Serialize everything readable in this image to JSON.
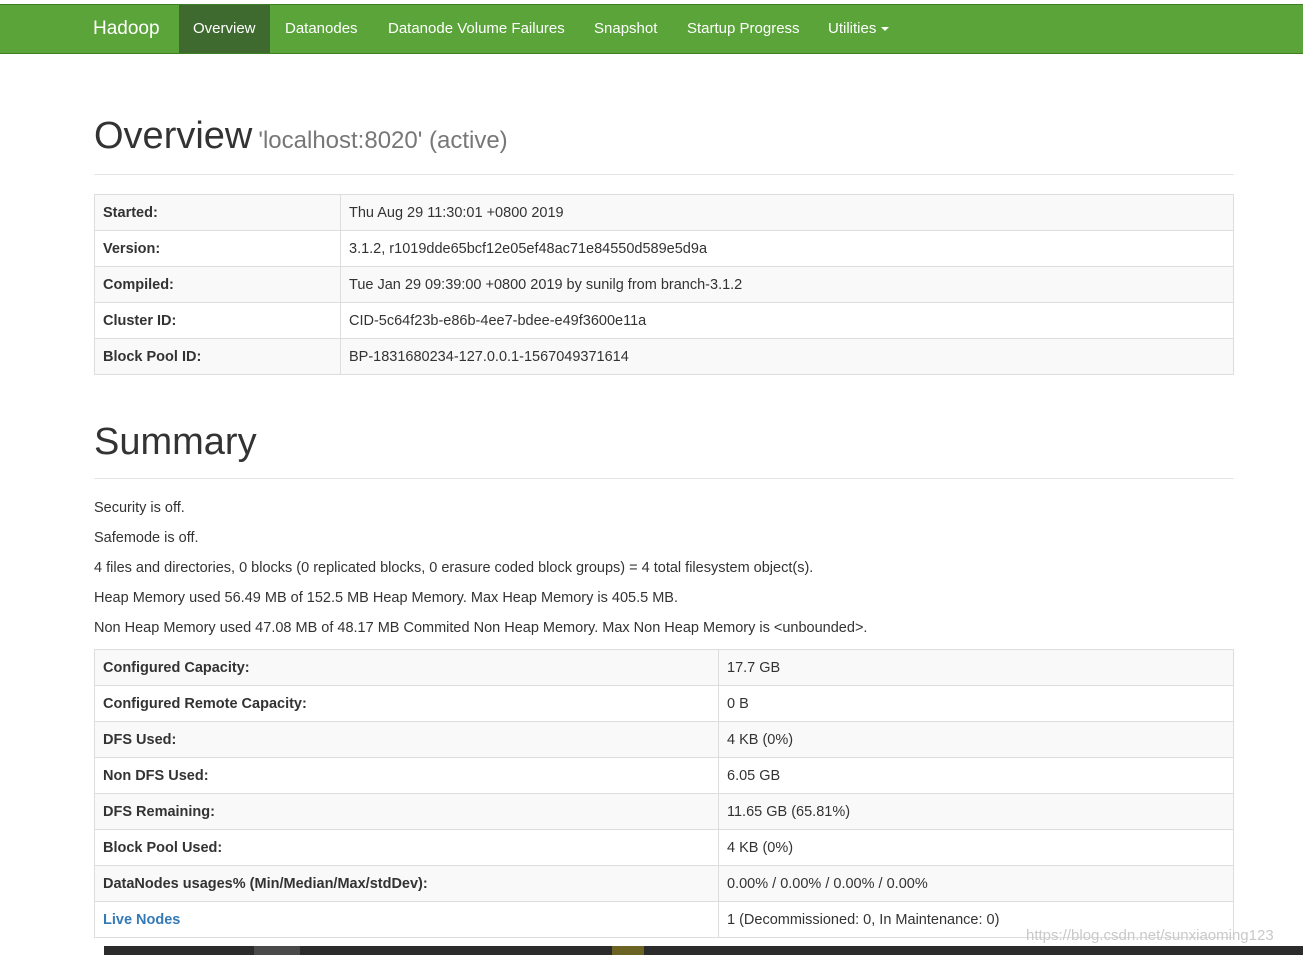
{
  "navbar": {
    "brand": "Hadoop",
    "items": [
      {
        "label": "Overview",
        "active": true
      },
      {
        "label": "Datanodes"
      },
      {
        "label": "Datanode Volume Failures"
      },
      {
        "label": "Snapshot"
      },
      {
        "label": "Startup Progress"
      },
      {
        "label": "Utilities"
      }
    ],
    "color": "#5aa43a",
    "active_color": "#3e6a2f"
  },
  "overview": {
    "title": "Overview",
    "subtitle": "'localhost:8020' (active)",
    "rows": [
      {
        "label": "Started:",
        "value": "Thu Aug 29 11:30:01 +0800 2019"
      },
      {
        "label": "Version:",
        "value": "3.1.2, r1019dde65bcf12e05ef48ac71e84550d589e5d9a"
      },
      {
        "label": "Compiled:",
        "value": "Tue Jan 29 09:39:00 +0800 2019 by sunilg from branch-3.1.2"
      },
      {
        "label": "Cluster ID:",
        "value": "CID-5c64f23b-e86b-4ee7-bdee-e49f3600e11a"
      },
      {
        "label": "Block Pool ID:",
        "value": "BP-1831680234-127.0.0.1-1567049371614"
      }
    ]
  },
  "summary": {
    "title": "Summary",
    "lines": [
      "Security is off.",
      "Safemode is off.",
      "4 files and directories, 0 blocks (0 replicated blocks, 0 erasure coded block groups) = 4 total filesystem object(s).",
      "Heap Memory used 56.49 MB of 152.5 MB Heap Memory. Max Heap Memory is 405.5 MB.",
      "Non Heap Memory used 47.08 MB of 48.17 MB Commited Non Heap Memory. Max Non Heap Memory is <unbounded>."
    ],
    "rows": [
      {
        "label": "Configured Capacity:",
        "value": "17.7 GB"
      },
      {
        "label": "Configured Remote Capacity:",
        "value": "0 B"
      },
      {
        "label": "DFS Used:",
        "value": "4 KB (0%)"
      },
      {
        "label": "Non DFS Used:",
        "value": "6.05 GB"
      },
      {
        "label": "DFS Remaining:",
        "value": "11.65 GB (65.81%)"
      },
      {
        "label": "Block Pool Used:",
        "value": "4 KB (0%)"
      },
      {
        "label": "DataNodes usages% (Min/Median/Max/stdDev):",
        "value": "0.00% / 0.00% / 0.00% / 0.00%"
      },
      {
        "label": "Live Nodes",
        "value": "1 (Decommissioned: 0, In Maintenance: 0)",
        "link": true
      }
    ]
  },
  "watermark": "https://blog.csdn.net/sunxiaoming123",
  "icons": {
    "utilities_dropdown": "caret-down-icon"
  }
}
